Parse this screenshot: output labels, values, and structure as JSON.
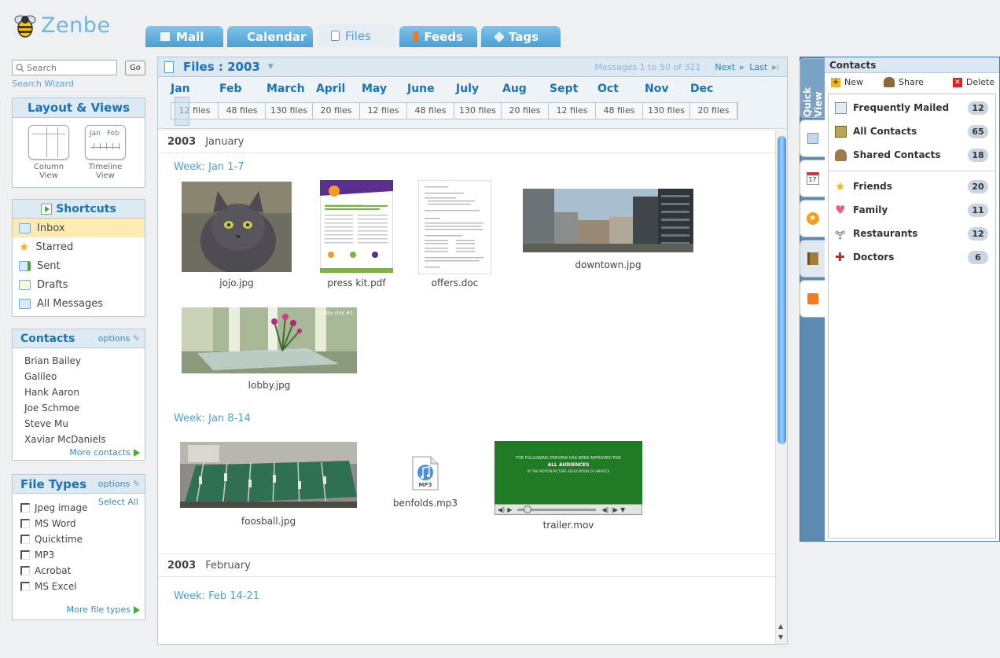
{
  "app": {
    "logo_text": "Zenbe"
  },
  "tabs": [
    {
      "label": "Mail",
      "icon": "mail-icon",
      "color": "#f0f4f8"
    },
    {
      "label": "Calendar",
      "icon": "calendar-icon",
      "color": "#f6b23a"
    },
    {
      "label": "Files",
      "icon": "file-icon",
      "color": "#5a9ccd"
    },
    {
      "label": "Feeds",
      "icon": "rss-icon",
      "color": "#f47a20"
    },
    {
      "label": "Tags",
      "icon": "tag-icon",
      "color": "#e8f0f7"
    }
  ],
  "search": {
    "placeholder": "Search",
    "go_label": "Go",
    "wizard_label": "Search Wizard"
  },
  "layout": {
    "title": "Layout & Views",
    "column_label": "Column View",
    "timeline_label": "Timeline View",
    "timeline_jan": "Jan",
    "timeline_feb": "Feb"
  },
  "shortcuts": {
    "title": "Shortcuts",
    "items": [
      {
        "label": "Inbox",
        "icon": "inbox-icon",
        "selected": true
      },
      {
        "label": "Starred",
        "icon": "star-icon",
        "selected": false
      },
      {
        "label": "Sent",
        "icon": "sent-icon",
        "selected": false
      },
      {
        "label": "Drafts",
        "icon": "drafts-icon",
        "selected": false
      },
      {
        "label": "All Messages",
        "icon": "all-messages-icon",
        "selected": false
      }
    ]
  },
  "contacts_panel": {
    "title": "Contacts",
    "options_label": "options",
    "items": [
      "Brian Bailey",
      "Galileo",
      "Hank Aaron",
      "Joe Schmoe",
      "Steve Mu",
      "Xaviar McDaniels"
    ],
    "more_label": "More contacts"
  },
  "file_types": {
    "title": "File Types",
    "options_label": "options",
    "select_all_label": "Select All",
    "items": [
      "Jpeg image",
      "MS Word",
      "Quicktime",
      "MP3",
      "Acrobat",
      "MS Excel"
    ],
    "more_label": "More file types"
  },
  "files": {
    "title": "Files : 2003",
    "nav_text": "Messages 1 to 50 of 321",
    "next_label": "Next",
    "last_label": "Last",
    "months": [
      {
        "name": "Jan",
        "count": "12 files"
      },
      {
        "name": "Feb",
        "count": "48 files"
      },
      {
        "name": "March",
        "count": "130 files"
      },
      {
        "name": "April",
        "count": "20 files"
      },
      {
        "name": "May",
        "count": "12 files"
      },
      {
        "name": "June",
        "count": "48 files"
      },
      {
        "name": "July",
        "count": "130 files"
      },
      {
        "name": "Aug",
        "count": "20 files"
      },
      {
        "name": "Sept",
        "count": "12 files"
      },
      {
        "name": "Oct",
        "count": "48 files"
      },
      {
        "name": "Nov",
        "count": "130 files"
      },
      {
        "name": "Dec",
        "count": "20 files"
      }
    ],
    "sections": [
      {
        "year": "2003",
        "month": "January"
      },
      {
        "year": "2003",
        "month": "February"
      }
    ],
    "weeks": [
      "Week: Jan 1-7",
      "Week: Jan 8-14",
      "Week: Feb 14-21"
    ],
    "items": [
      {
        "name": "jojo.jpg"
      },
      {
        "name": "press kit.pdf"
      },
      {
        "name": "offers.doc"
      },
      {
        "name": "downtown.jpg"
      },
      {
        "name": "lobby.jpg"
      },
      {
        "name": "foosball.jpg"
      },
      {
        "name": "benfolds.mp3"
      },
      {
        "name": "trailer.mov"
      }
    ],
    "pdf_heading": "Become smart and precise without a computer",
    "mp3_badge": "MP3",
    "lobby_overlay": "lobby shot #1",
    "trailer": {
      "line1": "THE FOLLOWING PREVIEW HAS BEEN APPROVED FOR",
      "line2": "ALL AUDIENCES",
      "line3": "BY THE MOTION PICTURE ASSOCIATION OF AMERICA"
    }
  },
  "quick_view": {
    "tab_label": "Quick View",
    "tabs": [
      "contacts-card-icon",
      "calendar-17-icon",
      "star-badge-icon",
      "notebook-icon",
      "rss-icon"
    ],
    "calendar_day": "17",
    "title": "Contacts",
    "new_label": "New",
    "share_label": "Share",
    "delete_label": "Delete",
    "groups1": [
      {
        "label": "Frequently Mailed",
        "count": "12",
        "icon": "frequent-mail-icon"
      },
      {
        "label": "All Contacts",
        "count": "65",
        "icon": "address-book-icon"
      },
      {
        "label": "Shared Contacts",
        "count": "18",
        "icon": "shared-contacts-icon"
      }
    ],
    "groups2": [
      {
        "label": "Friends",
        "count": "20",
        "icon": "star-icon"
      },
      {
        "label": "Family",
        "count": "11",
        "icon": "heart-icon"
      },
      {
        "label": "Restaurants",
        "count": "12",
        "icon": "cocktail-icon"
      },
      {
        "label": "Doctors",
        "count": "6",
        "icon": "red-cross-icon"
      }
    ]
  }
}
